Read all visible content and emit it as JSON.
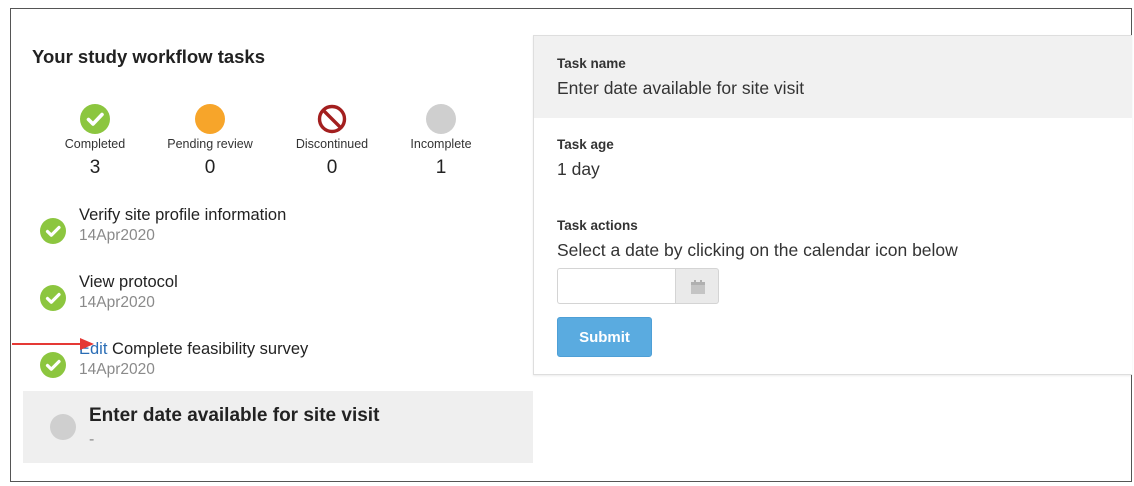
{
  "left": {
    "title": "Your study workflow tasks",
    "stats": [
      {
        "label": "Completed",
        "count": "3",
        "icon": "check-circle-icon",
        "color": "#8cc63f"
      },
      {
        "label": "Pending review",
        "count": "0",
        "icon": "pending-circle-icon",
        "color": "#f7a52a"
      },
      {
        "label": "Discontinued",
        "count": "0",
        "icon": "prohibited-icon",
        "color": "#a31f1f"
      },
      {
        "label": "Incomplete",
        "count": "1",
        "icon": "empty-circle-icon",
        "color": "#cfcfcf"
      }
    ],
    "tasks": [
      {
        "name": "Verify site profile information",
        "date": "14Apr2020",
        "status": "completed"
      },
      {
        "name": "View protocol",
        "date": "14Apr2020",
        "status": "completed"
      },
      {
        "edit_label": "Edit",
        "name": "Complete feasibility survey",
        "date": "14Apr2020",
        "status": "completed"
      },
      {
        "name": "Enter date available for site visit",
        "date": "-",
        "status": "incomplete"
      }
    ]
  },
  "panel": {
    "task_name_label": "Task name",
    "task_name_value": "Enter date available for site visit",
    "task_age_label": "Task age",
    "task_age_value": "1 day",
    "task_actions_label": "Task actions",
    "task_actions_text": "Select a date by clicking on the calendar icon below",
    "date_value": "",
    "calendar_icon": "calendar-icon",
    "submit_label": "Submit"
  },
  "colors": {
    "completed": "#8cc63f",
    "pending": "#f7a52a",
    "discontinued": "#a31f1f",
    "incomplete": "#cfcfcf",
    "submit": "#5aabe0",
    "arrow": "#e53935",
    "link": "#2a6db5"
  }
}
